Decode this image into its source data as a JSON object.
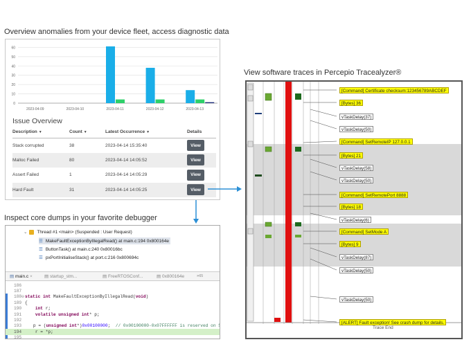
{
  "captions": {
    "overview": "Overview anomalies from your device fleet, access diagnostic data",
    "traces": "View software traces in Percepio Tracealyzer®",
    "debugger": "Inspect core dumps in your favorite debugger"
  },
  "chart_data": {
    "type": "bar",
    "categories": [
      "2023-04-09",
      "2023-04-10",
      "2023-04-11",
      "2023-04-12",
      "2023-04-13"
    ],
    "series": [
      {
        "values": [
          0,
          0,
          61,
          38,
          14
        ],
        "color": "#1aaee8"
      },
      {
        "values": [
          0,
          0,
          4,
          4,
          4
        ],
        "color": "#2ed06a"
      },
      {
        "values": [
          0,
          0,
          0,
          0,
          1
        ],
        "color": "#1c2a7a"
      }
    ],
    "yticks": [
      0,
      10,
      20,
      30,
      40,
      50,
      60
    ],
    "ylim": [
      0,
      64
    ],
    "grid": true
  },
  "issues": {
    "title": "Issue Overview",
    "columns": [
      "Description",
      "Count",
      "Latest Occurrence",
      "Details"
    ],
    "rows": [
      {
        "description": "Stack corrupted",
        "count": "38",
        "latest": "2023-04-14 15:35:40",
        "action": "View"
      },
      {
        "description": "Malloc Failed",
        "count": "80",
        "latest": "2023-04-14 14:05:52",
        "action": "View"
      },
      {
        "description": "Assert Failed",
        "count": "1",
        "latest": "2023-04-14 14:05:29",
        "action": "View"
      },
      {
        "description": "Hard Fault",
        "count": "31",
        "latest": "2023-04-14 14:05:25",
        "action": "View"
      }
    ]
  },
  "debugger": {
    "thread": "Thread #1 <main> (Suspended : User Request)",
    "frames": [
      "MakeFaultExceptionByIllegalRead() at main.c:194 0x800164e",
      "ButtonTask() at main.c:240 0x80016bc",
      "pxPortInitialiseStack() at port.c:216 0x800694c"
    ],
    "tabs": [
      "main.c",
      "startup_stm...",
      "FreeRTOSConf...",
      "0x800164e",
      "»",
      "65"
    ],
    "code": [
      {
        "ln": "186",
        "text": ""
      },
      {
        "ln": "187",
        "text": ""
      },
      {
        "ln": "188⊖",
        "text": "static int MakeFaultExceptionByIllegalRead(void)"
      },
      {
        "ln": "189",
        "text": "{"
      },
      {
        "ln": "190",
        "text": "    int r;"
      },
      {
        "ln": "191",
        "text": "    volatile unsigned int* p;"
      },
      {
        "ln": "192",
        "text": ""
      },
      {
        "ln": "193",
        "text": "    p = (unsigned int*)0x00100000;  // 0x00100000-0x07FFFFFF is reserved on S"
      },
      {
        "ln": "194",
        "text": "    r = *p;"
      },
      {
        "ln": "195",
        "text": ""
      }
    ]
  },
  "trace": {
    "events": [
      {
        "label": "[Command] Certificate checksum:123456789ABCDEF",
        "style": "y"
      },
      {
        "label": "[Bytes] 36",
        "style": "y"
      },
      {
        "label": "vTaskDelay(37)",
        "style": "w"
      },
      {
        "label": "vTaskDelay(50)",
        "style": "w"
      },
      {
        "label": "[Command] SetRemoteIP 127.0.0.1",
        "style": "y"
      },
      {
        "label": "[Bytes] 21",
        "style": "y"
      },
      {
        "label": "vTaskDelay(58)",
        "style": "w"
      },
      {
        "label": "vTaskDelay(50)",
        "style": "w"
      },
      {
        "label": "[Command] SetRemotePort 8888",
        "style": "y"
      },
      {
        "label": "[Bytes] 18",
        "style": "y"
      },
      {
        "label": "vTaskDelay(6)",
        "style": "w"
      },
      {
        "label": "[Command] SetMode A",
        "style": "y"
      },
      {
        "label": "[Bytes] 9",
        "style": "y"
      },
      {
        "label": "vTaskDelay(87)",
        "style": "w"
      },
      {
        "label": "vTaskDelay(50)",
        "style": "w"
      },
      {
        "label": "vTaskDelay(50)",
        "style": "w"
      },
      {
        "label": "[ALERT] Fault exception! See crash dump for details.",
        "style": "y"
      }
    ],
    "trace_end": "Trace End"
  },
  "colors": {
    "accent": "#2b8fd6",
    "fault": "#e01010",
    "task_green": "#6aa832"
  }
}
